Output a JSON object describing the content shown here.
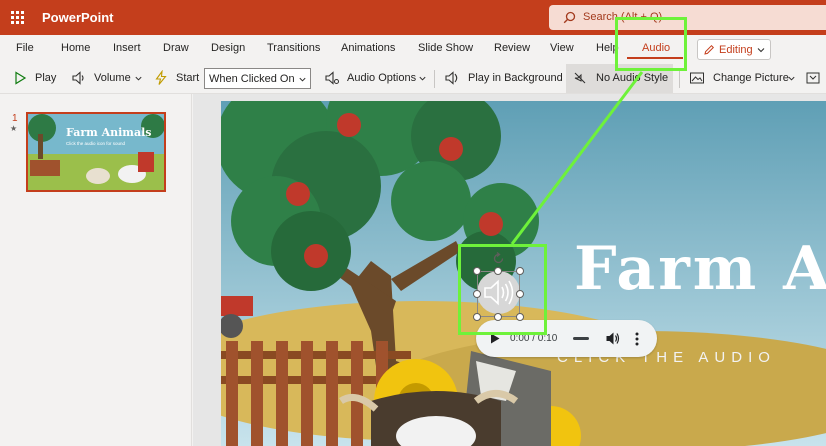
{
  "titlebar": {
    "app_name": "PowerPoint",
    "search_placeholder": "Search (Alt + Q)"
  },
  "menu": {
    "tabs": [
      {
        "label": "File"
      },
      {
        "label": "Home"
      },
      {
        "label": "Insert"
      },
      {
        "label": "Draw"
      },
      {
        "label": "Design"
      },
      {
        "label": "Transitions"
      },
      {
        "label": "Animations"
      },
      {
        "label": "Slide Show"
      },
      {
        "label": "Review"
      },
      {
        "label": "View"
      },
      {
        "label": "Help"
      },
      {
        "label": "Audio",
        "active": true
      }
    ],
    "editing_label": "Editing"
  },
  "ribbon": {
    "play": "Play",
    "volume": "Volume",
    "start": "Start",
    "start_value": "When Clicked On",
    "audio_options": "Audio Options",
    "play_in_background": "Play in Background",
    "no_audio_style": "No Audio Style",
    "change_picture": "Change Picture"
  },
  "slides": {
    "current_number": "1",
    "thumb_title": "Farm Animals",
    "thumb_subtitle": "Click the audio icon for sound"
  },
  "slide": {
    "title": "Farm A",
    "subtitle": "CLICK THE AUDIO"
  },
  "player": {
    "time": "0:00 / 0:10"
  },
  "colors": {
    "accent": "#c43e1c",
    "highlight": "#6ef23a",
    "sky": "#6fb3c9",
    "tree": "#2e7a45"
  }
}
